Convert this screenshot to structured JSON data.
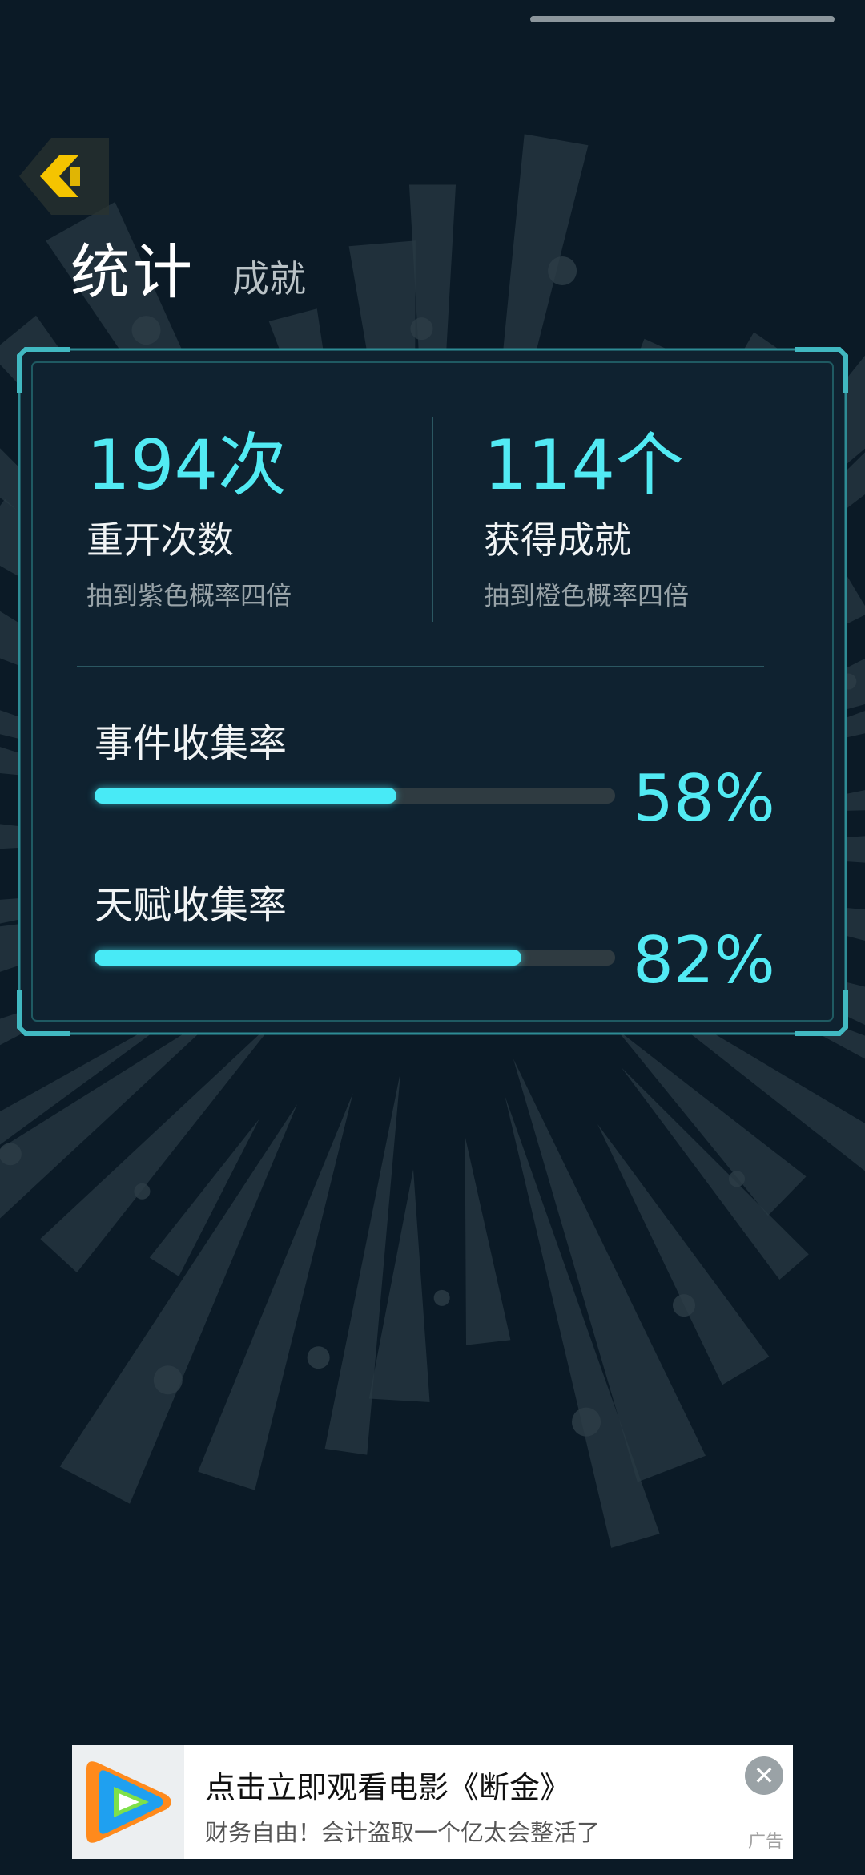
{
  "header": {
    "title": "统计",
    "tab_achievements": "成就"
  },
  "stats": {
    "restarts": {
      "value": "194次",
      "label": "重开次数",
      "sub": "抽到紫色概率四倍"
    },
    "achievements": {
      "value": "114个",
      "label": "获得成就",
      "sub": "抽到橙色概率四倍"
    }
  },
  "rates": [
    {
      "label": "事件收集率",
      "percent_text": "58%",
      "fill": 0.58
    },
    {
      "label": "天赋收集率",
      "percent_text": "82%",
      "fill": 0.82
    }
  ],
  "ad": {
    "title": "点击立即观看电影《断金》",
    "description": "财务自由！会计盗取一个亿太会整活了",
    "tag": "广告",
    "close_icon": "close-icon"
  },
  "colors": {
    "accent": "#52eaf3",
    "background": "#0b1a26",
    "back_button": "#f5c400"
  }
}
